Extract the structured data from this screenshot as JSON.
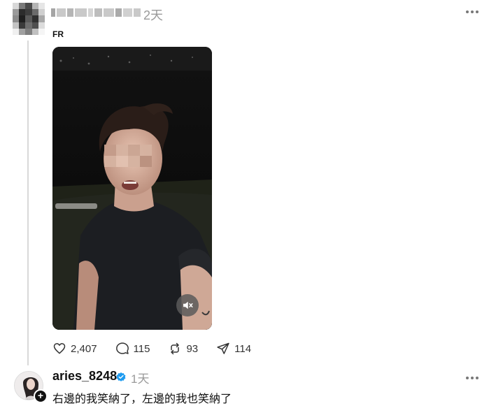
{
  "post": {
    "username": "",
    "time": "2天",
    "caption": "FR",
    "actions": {
      "like_count": "2,407",
      "comment_count": "115",
      "repost_count": "93",
      "share_count": "114"
    },
    "icons": [
      "more-icon",
      "mute-icon",
      "heart-icon",
      "comment-icon",
      "repost-icon",
      "share-icon"
    ]
  },
  "reply": {
    "username": "aries_8248",
    "time": "1天",
    "text": "右邊的我笑納了，左邊的我也笑納了",
    "follow_symbol": "+",
    "icons": [
      "verified-icon",
      "more-icon",
      "follow-plus-icon"
    ]
  },
  "colors": {
    "verified": "#1d9bf0",
    "muted_text": "#9a9a9a",
    "thread_line": "#d9d9d9"
  }
}
